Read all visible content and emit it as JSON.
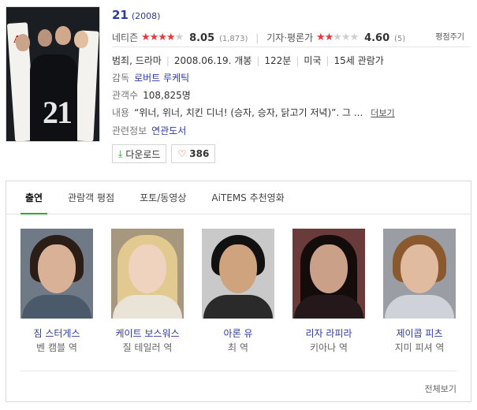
{
  "movie": {
    "title": "21",
    "year": "(2008)"
  },
  "ratings": {
    "netizen": {
      "label": "네티즌",
      "score": "8.05",
      "count": "(1,873)",
      "stars_filled": 4
    },
    "critic": {
      "label": "기자·평론가",
      "score": "4.60",
      "count": "(5)",
      "stars_filled": 2
    },
    "review_button": "평점주기"
  },
  "meta": {
    "genre": "범죄, 드라마",
    "release": "2008.06.19. 개봉",
    "runtime": "122분",
    "country": "미국",
    "age_rating": "15세 관람가",
    "director_label": "감독",
    "director": "로버트 루케틱",
    "audience_label": "관객수",
    "audience": "108,825명",
    "synopsis_label": "내용",
    "synopsis": "“위너, 위너, 치킨 디너! (승자, 승자, 닭고기 저녁)”. 그 ...",
    "more_link": "더보기",
    "related_label": "관련정보",
    "related": "연관도서"
  },
  "buttons": {
    "download": "다운로드",
    "likes": "386"
  },
  "tabs": [
    {
      "label": "출연",
      "active": true
    },
    {
      "label": "관람객 평점",
      "active": false
    },
    {
      "label": "포토/동영상",
      "active": false
    },
    {
      "label": "AiTEMS 추천영화",
      "active": false
    }
  ],
  "cast": [
    {
      "name": "짐 스터게스",
      "role": "벤 캠블 역"
    },
    {
      "name": "케이트 보스워스",
      "role": "질 테일러 역"
    },
    {
      "name": "아론 유",
      "role": "최 역"
    },
    {
      "name": "리자 라피라",
      "role": "키아나 역"
    },
    {
      "name": "제이콥 피츠",
      "role": "지미 피셔 역"
    }
  ],
  "see_all": "전체보기",
  "colors": {
    "link_blue": "#2b3aa6",
    "star_red": "#e8383d",
    "tab_green": "#2dab33"
  }
}
